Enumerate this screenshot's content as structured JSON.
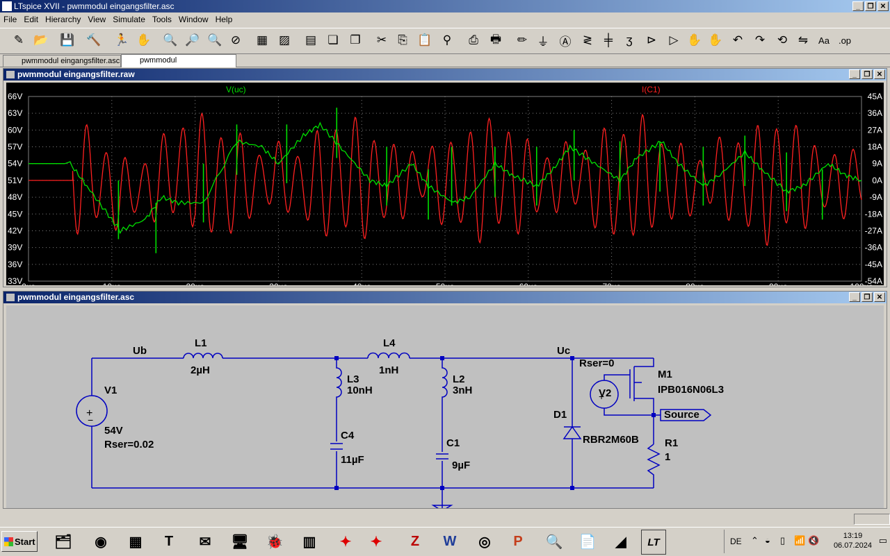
{
  "window": {
    "title": "LTspice XVII - pwmmodul eingangsfilter.asc",
    "min_label": "_",
    "restore_label": "❐",
    "close_label": "✕"
  },
  "menu": [
    "File",
    "Edit",
    "Hierarchy",
    "View",
    "Simulate",
    "Tools",
    "Window",
    "Help"
  ],
  "toolbar": [
    {
      "name": "new-schematic-icon",
      "glyph": "✎"
    },
    {
      "name": "open-icon",
      "glyph": "📂"
    },
    {
      "name": "save-icon",
      "glyph": "💾"
    },
    {
      "name": "control-panel-icon",
      "glyph": "🔨"
    },
    {
      "name": "run-icon",
      "glyph": "🏃"
    },
    {
      "name": "halt-icon",
      "glyph": "✋"
    },
    {
      "name": "zoom-in-icon",
      "glyph": "🔍"
    },
    {
      "name": "pan-icon",
      "glyph": "🔎"
    },
    {
      "name": "zoom-out-icon",
      "glyph": "🔍"
    },
    {
      "name": "zoom-fit-icon",
      "glyph": "⊘"
    },
    {
      "name": "autorange-icon",
      "glyph": "▦"
    },
    {
      "name": "grid-icon",
      "glyph": "▨"
    },
    {
      "name": "tile-horizontal-icon",
      "glyph": "▤"
    },
    {
      "name": "cascade-icon",
      "glyph": "❏"
    },
    {
      "name": "tile-vertical-icon",
      "glyph": "❐"
    },
    {
      "name": "cut-icon",
      "glyph": "✂"
    },
    {
      "name": "copy-icon",
      "glyph": "⎘"
    },
    {
      "name": "paste-icon",
      "glyph": "📋"
    },
    {
      "name": "find-icon",
      "glyph": "⚲"
    },
    {
      "name": "print-setup-icon",
      "glyph": "⎙"
    },
    {
      "name": "print-icon",
      "glyph": "🖶"
    },
    {
      "name": "draw-wire-icon",
      "glyph": "✏"
    },
    {
      "name": "ground-icon",
      "glyph": "⏚"
    },
    {
      "name": "label-net-icon",
      "glyph": "Ⓐ"
    },
    {
      "name": "resistor-icon",
      "glyph": "≷"
    },
    {
      "name": "capacitor-icon",
      "glyph": "╪"
    },
    {
      "name": "inductor-icon",
      "glyph": "ʒ"
    },
    {
      "name": "diode-icon",
      "glyph": "⊳"
    },
    {
      "name": "component-icon",
      "glyph": "▷"
    },
    {
      "name": "move-icon",
      "glyph": "✋"
    },
    {
      "name": "drag-icon",
      "glyph": "✋"
    },
    {
      "name": "undo-icon",
      "glyph": "↶"
    },
    {
      "name": "redo-icon",
      "glyph": "↷"
    },
    {
      "name": "rotate-icon",
      "glyph": "⟲"
    },
    {
      "name": "mirror-icon",
      "glyph": "⇋"
    },
    {
      "name": "text-icon",
      "glyph": "Aa"
    },
    {
      "name": "spice-directive-icon",
      "glyph": ".op"
    }
  ],
  "tabs": [
    {
      "label": "pwmmodul eingangsfilter.asc",
      "active": false
    },
    {
      "label": "pwmmodul eingangsfilter.raw",
      "active": true
    }
  ],
  "plot_window": {
    "title": "pwmmodul eingangsfilter.raw",
    "trace_v_label": "V(uc)",
    "trace_i_label": "I(C1)"
  },
  "chart_data": {
    "type": "line",
    "x_unit": "µs",
    "xlim": [
      0,
      100
    ],
    "x_ticks": [
      "0µs",
      "10µs",
      "20µs",
      "30µs",
      "40µs",
      "50µs",
      "60µs",
      "70µs",
      "80µs",
      "90µs",
      "100µs"
    ],
    "y_left_ticks": [
      "66V",
      "63V",
      "60V",
      "57V",
      "54V",
      "51V",
      "48V",
      "45V",
      "42V",
      "39V",
      "36V",
      "33V"
    ],
    "y_right_ticks": [
      "45A",
      "36A",
      "27A",
      "18A",
      "9A",
      "0A",
      "-9A",
      "-18A",
      "-27A",
      "-36A",
      "-45A",
      "-54A"
    ],
    "ylim_left": [
      33,
      66
    ],
    "ylim_right": [
      -54,
      45
    ],
    "series": [
      {
        "name": "V(uc)",
        "color": "#00e000",
        "axis": "left",
        "x": [
          0,
          5,
          7,
          10,
          11,
          14,
          16,
          18,
          21,
          25,
          28,
          30,
          33,
          35,
          38,
          41,
          43,
          46,
          48,
          51,
          53,
          56,
          58,
          61,
          63,
          65,
          68,
          71,
          73,
          76,
          78,
          81,
          83,
          86,
          88,
          91,
          93,
          96,
          98,
          100
        ],
        "y": [
          54,
          54,
          50,
          44,
          42,
          44,
          48,
          47,
          47,
          58,
          57,
          54,
          59,
          61,
          56,
          51,
          50,
          54,
          50,
          47,
          48,
          54,
          52,
          50,
          53,
          57,
          54,
          51,
          55,
          58,
          54,
          50,
          52,
          56,
          53,
          49,
          50,
          54,
          52,
          51
        ]
      },
      {
        "name": "I(C1)",
        "color": "#ff2020",
        "axis": "right",
        "x": [
          0,
          5.3,
          100
        ],
        "y": [
          0,
          0,
          0
        ],
        "oscillation": {
          "start_us": 5.3,
          "period_us": 2.3,
          "amplitude_A": 30
        }
      }
    ]
  },
  "schematic_window": {
    "title": "pwmmodul eingangsfilter.asc",
    "labels": {
      "ub": "Ub",
      "uc": "Uc",
      "l1": "L1",
      "l1v": "2µH",
      "l4": "L4",
      "l4v": "1nH",
      "l3": "L3",
      "l3v": "10nH",
      "l2": "L2",
      "l2v": "3nH",
      "c4": "C4",
      "c4v": "11µF",
      "c1": "C1",
      "c1v": "9µF",
      "v1": "V1",
      "v1v": "54V",
      "v1r": "Rser=0.02",
      "v2": "V2",
      "v2r": "Rser=0",
      "m1": "M1",
      "m1v": "IPB016N06L3",
      "d1": "D1",
      "d1v": "RBR2M60B",
      "r1": "R1",
      "r1v": "1",
      "src": "Source"
    }
  },
  "taskbar": {
    "start_label": "Start",
    "apps": [
      {
        "name": "file-explorer-icon",
        "glyph": "🗂"
      },
      {
        "name": "chrome-icon",
        "glyph": "◉"
      },
      {
        "name": "calculator-icon",
        "glyph": "▦"
      },
      {
        "name": "text-editor-icon",
        "glyph": "T"
      },
      {
        "name": "thunderbird-icon",
        "glyph": "✉"
      },
      {
        "name": "network-icon",
        "glyph": "🖥"
      },
      {
        "name": "ladybug-icon",
        "glyph": "🐞"
      },
      {
        "name": "system-info-icon",
        "glyph": "▥"
      },
      {
        "name": "filezilla-red-1-icon",
        "glyph": "✦"
      },
      {
        "name": "filezilla-red-2-icon",
        "glyph": "✦"
      },
      {
        "name": "filezilla-icon",
        "glyph": "Z"
      },
      {
        "name": "word-icon",
        "glyph": "W"
      },
      {
        "name": "obs-icon",
        "glyph": "◎"
      },
      {
        "name": "powerpoint-icon",
        "glyph": "P"
      },
      {
        "name": "search-tool-icon",
        "glyph": "🔍"
      },
      {
        "name": "notepad-icon",
        "glyph": "📄"
      },
      {
        "name": "graph-tool-icon",
        "glyph": "◢"
      },
      {
        "name": "ltspice-icon",
        "glyph": "LT"
      }
    ],
    "lang": "DE",
    "time": "13:19",
    "date": "06.07.2024"
  }
}
